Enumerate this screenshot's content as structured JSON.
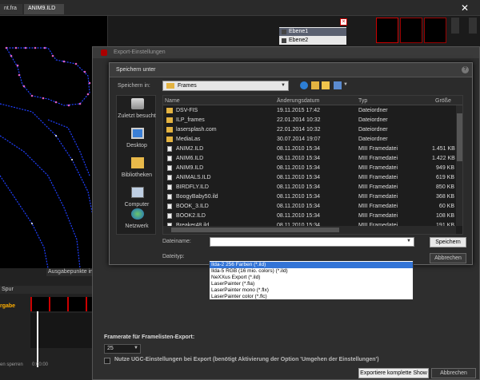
{
  "app": {
    "tabs": [
      "nt.fra",
      "ANIM9.ILD"
    ],
    "close_glyph": "✕",
    "layers": [
      "Ebene1",
      "Ebene2"
    ],
    "side_labels": [
      "Be",
      "hin",
      "Sp",
      "Vi"
    ],
    "output_points_label": "Ausgabepunkte in",
    "track_header": "Spur",
    "track_name": "rgabe",
    "lock_label": "en sperren",
    "time_label": "0:00:00"
  },
  "export_dialog": {
    "title": "Export-Einstellungen",
    "framerate_label": "Framerate für Framelisten-Export:",
    "framerate_value": "25",
    "ugc_label": "Nutze UGC-Einstellungen bei Export (benötigt Aktivierung der Option 'Umgehen der Einstellungen')",
    "export_button": "Exportiere komplette Show",
    "cancel_button": "Abbrechen"
  },
  "save_dialog": {
    "title": "Speichern unter",
    "help_glyph": "?",
    "speichern_in_label": "Speichern in:",
    "folder": "Frames",
    "places": [
      "Zuletzt besucht",
      "Desktop",
      "Bibliotheken",
      "Computer",
      "Netzwerk"
    ],
    "columns": [
      "Name",
      "Änderungsdatum",
      "Typ",
      "Größe"
    ],
    "files": [
      {
        "name": "DSV-FIS",
        "date": "19.11.2015 17:42",
        "type": "Dateiordner",
        "size": "",
        "kind": "folder"
      },
      {
        "name": "ILP_frames",
        "date": "22.01.2014 10:32",
        "type": "Dateiordner",
        "size": "",
        "kind": "folder"
      },
      {
        "name": "lasersplash.com",
        "date": "22.01.2014 10:32",
        "type": "Dateiordner",
        "size": "",
        "kind": "folder"
      },
      {
        "name": "MediaLas",
        "date": "30.07.2014 19:07",
        "type": "Dateiordner",
        "size": "",
        "kind": "folder"
      },
      {
        "name": "ANIM2.ILD",
        "date": "08.11.2010 15:34",
        "type": "MIII Framedatei",
        "size": "1.451 KB",
        "kind": "file"
      },
      {
        "name": "ANIM6.ILD",
        "date": "08.11.2010 15:34",
        "type": "MIII Framedatei",
        "size": "1.422 KB",
        "kind": "file"
      },
      {
        "name": "ANIM9.ILD",
        "date": "08.11.2010 15:34",
        "type": "MIII Framedatei",
        "size": "949 KB",
        "kind": "file"
      },
      {
        "name": "ANIMALS.ILD",
        "date": "08.11.2010 15:34",
        "type": "MIII Framedatei",
        "size": "619 KB",
        "kind": "file"
      },
      {
        "name": "BIRDFLY.ILD",
        "date": "08.11.2010 15:34",
        "type": "MIII Framedatei",
        "size": "850 KB",
        "kind": "file"
      },
      {
        "name": "BoogyBaby50.ild",
        "date": "08.11.2010 15:34",
        "type": "MIII Framedatei",
        "size": "368 KB",
        "kind": "file"
      },
      {
        "name": "BOOK_3.ILD",
        "date": "08.11.2010 15:34",
        "type": "MIII Framedatei",
        "size": "60 KB",
        "kind": "file"
      },
      {
        "name": "BOOK2.ILD",
        "date": "08.11.2010 15:34",
        "type": "MIII Framedatei",
        "size": "108 KB",
        "kind": "file"
      },
      {
        "name": "Breaker48.ild",
        "date": "08.11.2010 15:34",
        "type": "MIII Framedatei",
        "size": "191 KB",
        "kind": "file"
      },
      {
        "name": "camera.ild",
        "date": "08.11.2010 15:34",
        "type": "MIII Framedatei",
        "size": "",
        "kind": "file"
      }
    ],
    "dateiname_label": "Dateiname:",
    "dateiname_value": "",
    "dateityp_label": "Dateityp:",
    "save_button": "Speichern",
    "cancel_button": "Abbrechen",
    "filetype_options": [
      "Ilda-2 256 Farben (*.ild)",
      "Ilda-5 RGB (16 mio. colors) (*.ild)",
      "NeXXus Export (*.ild)",
      "LaserPainter (*.fla)",
      "LaserPainter mono (*.flx)",
      "LaserPainter color (*.flc)"
    ],
    "selected_filetype": 0
  },
  "colors": {
    "selection": "#3374d6",
    "folder": "#e3b341",
    "laser_path": "#2040ff",
    "laser_points": "#e060c0"
  }
}
